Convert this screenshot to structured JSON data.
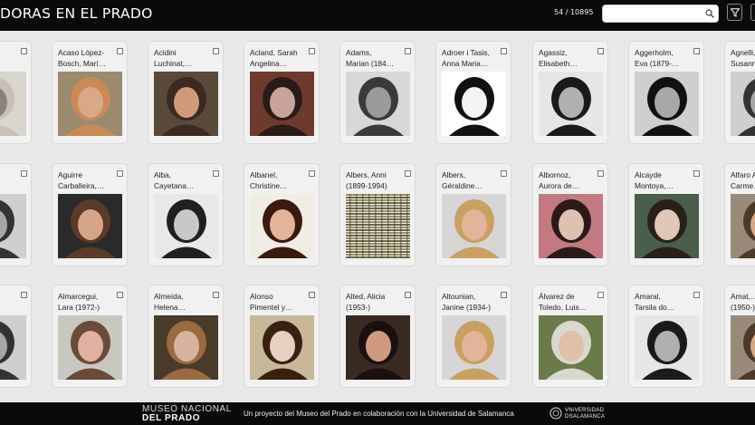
{
  "header": {
    "title": "DORAS EN EL PRADO",
    "count": "54 / 10895",
    "search_placeholder": "",
    "icons": [
      "search-icon",
      "filter-icon"
    ]
  },
  "cards": [
    {
      "name": "…t,",
      "photo": "sketch-grey"
    },
    {
      "name": "Acaso López-\nBosch, Marí…",
      "photo": "photo-color-glasses"
    },
    {
      "name": "Acidini\nLuchinat,…",
      "photo": "photo-color-warm"
    },
    {
      "name": "Acland, Sarah\nAngelina…",
      "photo": "photo-old-sepia"
    },
    {
      "name": "Adams,\nMarian (184…",
      "photo": "photo-bw-child"
    },
    {
      "name": "Adroer i Tasis,\nAnna Maria…",
      "photo": "drawing-bw"
    },
    {
      "name": "Agassiz,\nElisabeth…",
      "photo": "photo-bw-profile"
    },
    {
      "name": "Aggerholm,\nEva (1879-…",
      "photo": "photo-bw-dark"
    },
    {
      "name": "Agnelli,\nSusann…",
      "photo": "photo-bw"
    },
    {
      "name": "",
      "photo": "photo-bw"
    },
    {
      "name": "Aguirre\nCarballeira,…",
      "photo": "photo-color-stage"
    },
    {
      "name": "Alba,\nCayetana…",
      "photo": "photo-bw-portrait"
    },
    {
      "name": "Albanel,\nChristine…",
      "photo": "photo-color-dark-hair"
    },
    {
      "name": "Albers, Anni\n(1899-1994)",
      "photo": "textile"
    },
    {
      "name": "Albers,\nGéraldine…",
      "photo": "photo-color-blonde"
    },
    {
      "name": "Albornoz,\nAurora de…",
      "photo": "photo-color-pink"
    },
    {
      "name": "Alcayde\nMontoya,…",
      "photo": "painting-green"
    },
    {
      "name": "Alfaro A…\nCarme…",
      "photo": "photo-color"
    },
    {
      "name": "",
      "photo": "photo-bw"
    },
    {
      "name": "Almarcegui,\nLara (1972-)",
      "photo": "photo-color-blue"
    },
    {
      "name": "Almeida,\nHelena…",
      "photo": "photo-color-crowd"
    },
    {
      "name": "Alonso\nPimentel y…",
      "photo": "painting-curls"
    },
    {
      "name": "Alted, Alicia\n(1953-)",
      "photo": "photo-color-red"
    },
    {
      "name": "Altounian,\nJanine (1934-)",
      "photo": "photo-color-blonde"
    },
    {
      "name": "Álvarez de\nToledo, Luis…",
      "photo": "photo-color-outdoor"
    },
    {
      "name": "Amaral,\nTarsila do…",
      "photo": "photo-bw-profile"
    },
    {
      "name": "Amat,…\n(1950-)",
      "photo": "photo-color"
    }
  ],
  "footer": {
    "logo_line1": "MUSEO NACIONAL",
    "logo_line2": "DEL PRADO",
    "text": "Un proyecto del Museo del Prado en colaboración con la Universidad de Salamanca",
    "usal_line1": "VNiVERSiDAD",
    "usal_line2": "DSALAMANCA"
  }
}
